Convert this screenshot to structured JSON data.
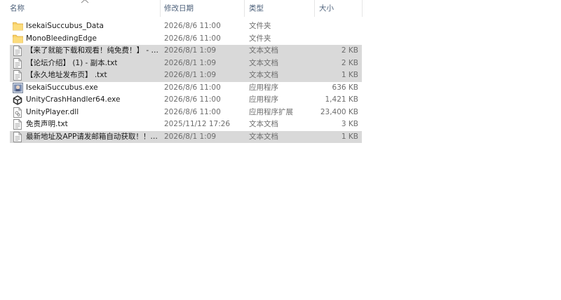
{
  "columns": {
    "name": "名称",
    "modified": "修改日期",
    "type": "类型",
    "size": "大小"
  },
  "files": [
    {
      "name": "IsekaiSuccubus_Data",
      "date": "2026/8/6 11:00",
      "type": "文件夹",
      "size": "",
      "icon": "folder-icon",
      "selected": false
    },
    {
      "name": "MonoBleedingEdge",
      "date": "2026/8/6 11:00",
      "type": "文件夹",
      "size": "",
      "icon": "folder-icon",
      "selected": false
    },
    {
      "name": "【来了就能下载和观看！纯免费！】 - 副...",
      "date": "2026/8/1 1:09",
      "type": "文本文档",
      "size": "2 KB",
      "icon": "text-file-icon",
      "selected": true
    },
    {
      "name": "【论坛介绍】 (1) - 副本.txt",
      "date": "2026/8/1 1:09",
      "type": "文本文档",
      "size": "2 KB",
      "icon": "text-file-icon",
      "selected": true
    },
    {
      "name": "【永久地址发布页】 .txt",
      "date": "2026/8/1 1:09",
      "type": "文本文档",
      "size": "1 KB",
      "icon": "text-file-icon",
      "selected": true
    },
    {
      "name": "IsekaiSuccubus.exe",
      "date": "2026/8/6 11:00",
      "type": "应用程序",
      "size": "636 KB",
      "icon": "app-exe-icon",
      "selected": false
    },
    {
      "name": "UnityCrashHandler64.exe",
      "date": "2026/8/6 11:00",
      "type": "应用程序",
      "size": "1,421 KB",
      "icon": "unity-icon",
      "selected": false
    },
    {
      "name": "UnityPlayer.dll",
      "date": "2026/8/6 11:00",
      "type": "应用程序扩展",
      "size": "23,400 KB",
      "icon": "dll-file-icon",
      "selected": false
    },
    {
      "name": "免责声明.txt",
      "date": "2025/11/12 17:26",
      "type": "文本文档",
      "size": "3 KB",
      "icon": "text-file-icon",
      "selected": false
    },
    {
      "name": "最新地址及APP请发邮箱自动获取！！！...",
      "date": "2026/8/1 1:09",
      "type": "文本文档",
      "size": "1 KB",
      "icon": "text-file-icon",
      "selected": true
    }
  ]
}
